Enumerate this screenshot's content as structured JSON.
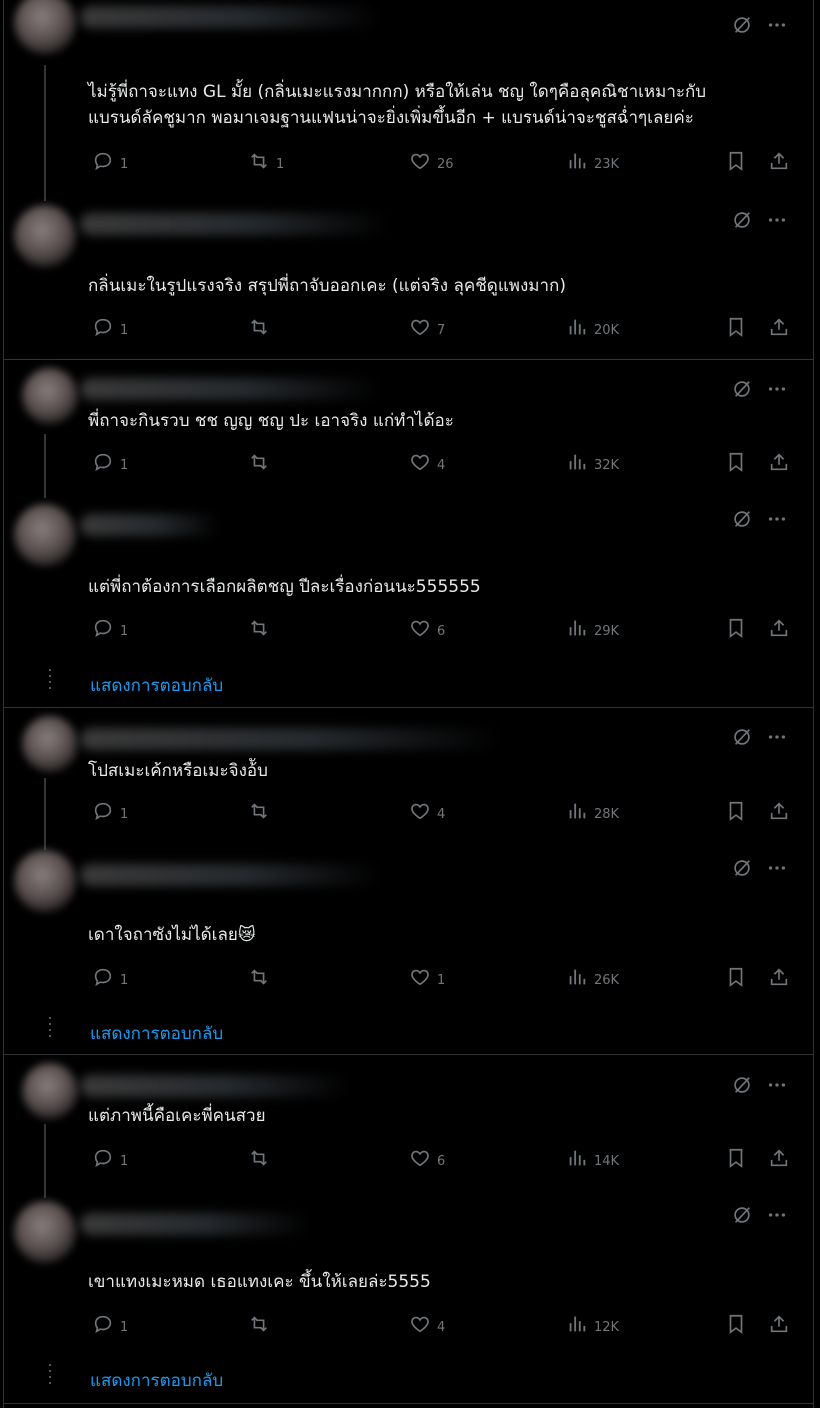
{
  "colors": {
    "background": "#000000",
    "text": "#e7e9ea",
    "muted": "#71767b",
    "link": "#1d9bf0",
    "divider": "#2f3336"
  },
  "icons": {
    "reply": "reply-icon",
    "repost": "repost-icon",
    "like": "heart-icon",
    "views": "views-icon",
    "bookmark": "bookmark-icon",
    "share": "share-icon",
    "grok": "grok-icon",
    "more": "more-icon"
  },
  "show_replies_label": "แสดงการตอบกลับ",
  "posts": [
    {
      "text": "ไม่รู้พี่ถาจะแทง GL มั้ย (กลิ่นเมะแรงมากกก) หรือให้เล่น ชญ ใดๆคือลุคณิชาเหมาะกับ\nแบรนด์ลัคชูมาก พอมาเจมฐานแฟนน่าจะยิ่งเพิ่มขึ้นอีก + แบรนด์น่าจะชูสฉ่ำๆเลยค่ะ",
      "replies": "1",
      "reposts": "1",
      "likes": "26",
      "views": "23K"
    },
    {
      "text": "กลิ่นเมะในรูปแรงจริง สรุปพี่ถาจับออกเคะ (แต่จริง ลุคชีดูแพงมาก)",
      "replies": "1",
      "reposts": "",
      "likes": "7",
      "views": "20K"
    },
    {
      "text": "พี่ถาจะกินรวบ ชช ญญ ชญ ปะ เอาจริง แก่ทำได้อะ",
      "replies": "1",
      "reposts": "",
      "likes": "4",
      "views": "32K"
    },
    {
      "text": "แต่พี่ถาต้องการเลือกผลิตชญ ปีละเรื่องก่อนนะ555555",
      "replies": "1",
      "reposts": "",
      "likes": "6",
      "views": "29K"
    },
    {
      "text": "โปสเมะเค้กหรือเมะจิงอ้ับ",
      "replies": "1",
      "reposts": "",
      "likes": "4",
      "views": "28K"
    },
    {
      "text": "เดาใจถาซังไม่ได้เลย",
      "emoji": "😿",
      "replies": "1",
      "reposts": "",
      "likes": "1",
      "views": "26K"
    },
    {
      "text": "แต่ภาพนี้คือเคะพี่คนสวย",
      "replies": "1",
      "reposts": "",
      "likes": "6",
      "views": "14K"
    },
    {
      "text": "เขาแทงเมะหมด เธอแทงเคะ ขึ้นให้เลยล่ะ5555",
      "replies": "1",
      "reposts": "",
      "likes": "4",
      "views": "12K"
    }
  ]
}
